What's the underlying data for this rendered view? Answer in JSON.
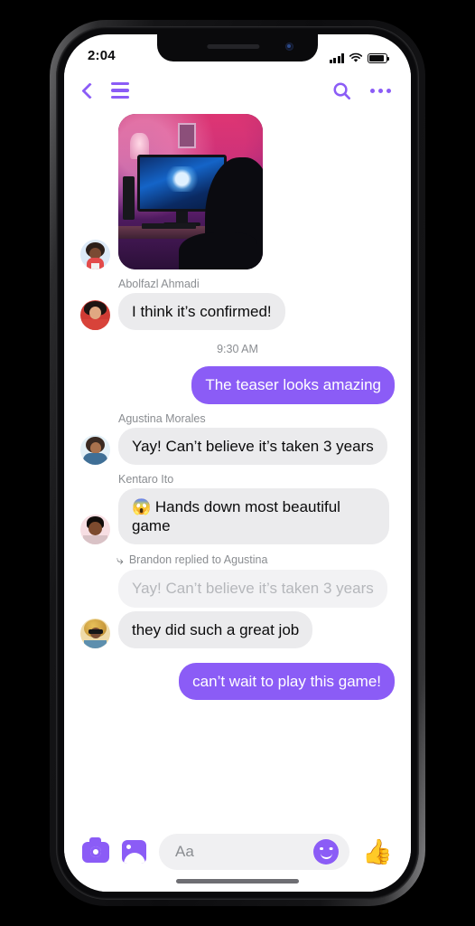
{
  "status_bar": {
    "time": "2:04",
    "signal_icon": "cellular-bars-icon",
    "wifi_icon": "wifi-icon",
    "battery_icon": "battery-icon"
  },
  "nav_bar": {
    "back_icon": "chevron-left-icon",
    "menu_icon": "hamburger-menu-icon",
    "search_icon": "search-icon",
    "more_icon": "more-options-icon",
    "accent_color": "#8b5cf6"
  },
  "thread": {
    "time_divider": "9:30 AM",
    "messages": [
      {
        "id": "m0",
        "type": "image",
        "direction": "in",
        "avatar": "av1",
        "alt": "gaming-room-photo"
      },
      {
        "id": "m1",
        "type": "text",
        "direction": "in",
        "sender": "Abolfazl Ahmadi",
        "text": "I think it’s confirmed!",
        "avatar": "av2"
      },
      {
        "id": "m2",
        "type": "text",
        "direction": "out",
        "text": "The teaser looks amazing"
      },
      {
        "id": "m3",
        "type": "text",
        "direction": "in",
        "sender": "Agustina Morales",
        "text": "Yay! Can’t believe it’s taken 3 years",
        "avatar": "av3"
      },
      {
        "id": "m4",
        "type": "text",
        "direction": "in",
        "sender": "Kentaro Ito",
        "text": "😱 Hands down most beautiful game",
        "avatar": "av4"
      },
      {
        "id": "m5",
        "type": "reply",
        "direction": "in",
        "reply_header": "Brandon replied to Agustina",
        "reply_icon": "reply-arrow-icon",
        "quoted_text": "Yay! Can’t believe it’s taken 3 years",
        "text": "they did such a great job",
        "avatar": "av5"
      },
      {
        "id": "m6",
        "type": "text",
        "direction": "out",
        "text": "can’t wait to play this game!"
      }
    ]
  },
  "composer": {
    "camera_icon": "camera-icon",
    "gallery_icon": "gallery-icon",
    "placeholder": "Aa",
    "input_value": "",
    "emoji_icon": "smiley-icon",
    "like_icon": "thumbs-up-icon",
    "like_glyph": "👍"
  },
  "colors": {
    "accent": "#8b5cf6",
    "incoming_bubble": "#ebebed",
    "quoted_bubble": "#f2f2f4",
    "muted_text": "#8a8d91"
  }
}
